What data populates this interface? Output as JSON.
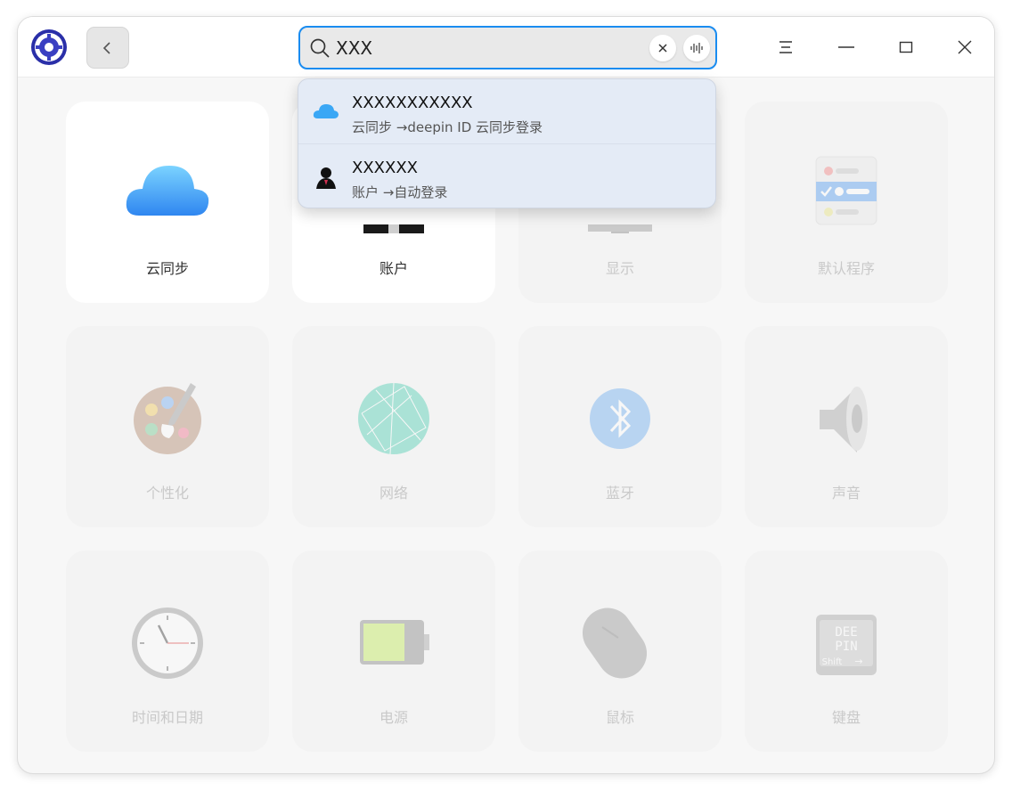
{
  "search": {
    "value": "XXX"
  },
  "suggestions": [
    {
      "title": "XXXXXXXXXXX",
      "subtitle": "云同步 →deepin ID 云同步登录",
      "icon": "cloud-icon"
    },
    {
      "title": "XXXXXX",
      "subtitle": "账户 →自动登录",
      "icon": "account-icon"
    }
  ],
  "modules": [
    {
      "label": "云同步",
      "icon": "cloud-icon",
      "active": true
    },
    {
      "label": "账户",
      "icon": "account-icon",
      "active": true
    },
    {
      "label": "显示",
      "icon": "display-icon",
      "active": false
    },
    {
      "label": "默认程序",
      "icon": "default-apps-icon",
      "active": false
    },
    {
      "label": "个性化",
      "icon": "palette-icon",
      "active": false
    },
    {
      "label": "网络",
      "icon": "network-icon",
      "active": false
    },
    {
      "label": "蓝牙",
      "icon": "bluetooth-icon",
      "active": false
    },
    {
      "label": "声音",
      "icon": "speaker-icon",
      "active": false
    },
    {
      "label": "时间和日期",
      "icon": "clock-icon",
      "active": false
    },
    {
      "label": "电源",
      "icon": "battery-icon",
      "active": false
    },
    {
      "label": "鼠标",
      "icon": "mouse-icon",
      "active": false
    },
    {
      "label": "键盘",
      "icon": "keyboard-icon",
      "active": false
    }
  ],
  "keyboard_keys": {
    "row1": "DEE",
    "row2": "PIN",
    "shift": "Shift",
    "arrow": "→"
  },
  "colors": {
    "accent": "#1a8cf0",
    "cloud": "#3aa7f5",
    "bluetooth": "#5ba4f0"
  }
}
